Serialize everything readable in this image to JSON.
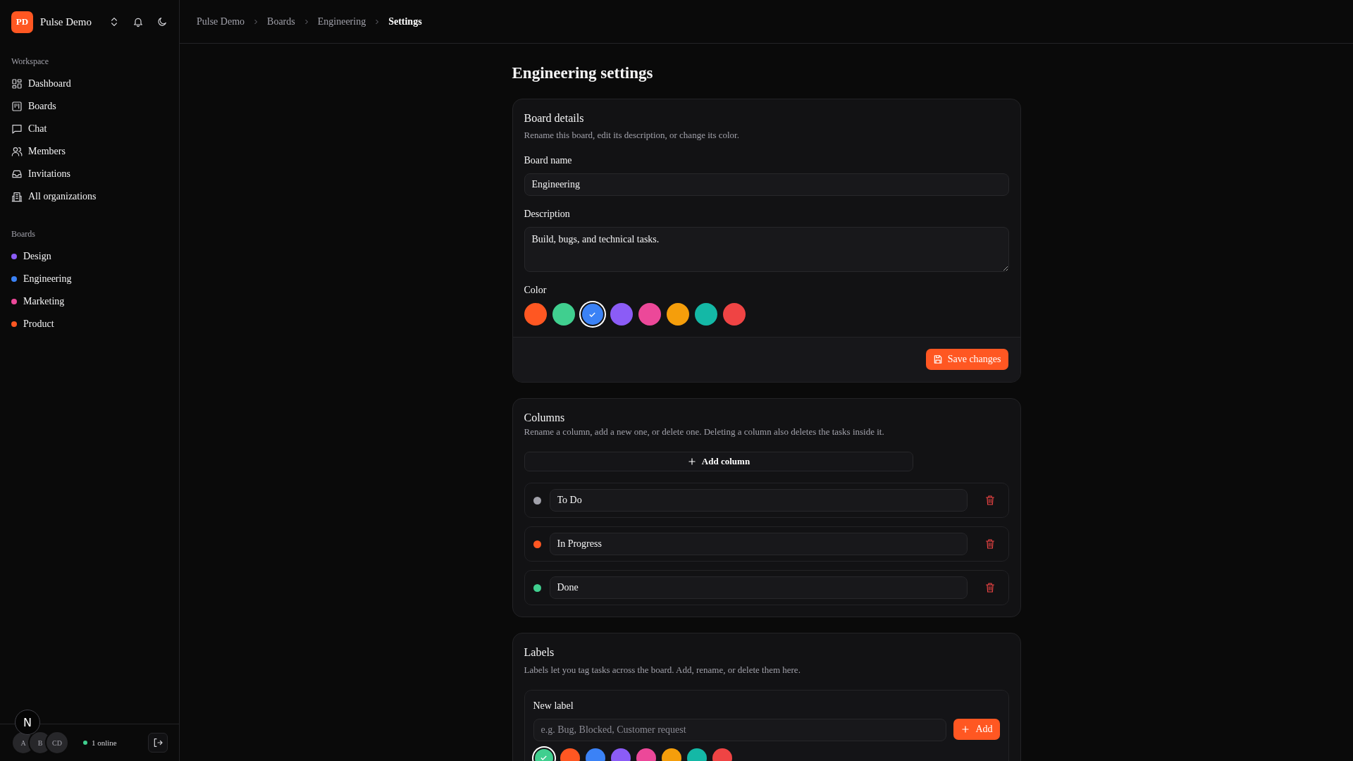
{
  "org": {
    "initials": "PD",
    "name": "Pulse Demo"
  },
  "sidebar": {
    "workspace_heading": "Workspace",
    "items": [
      {
        "label": "Dashboard",
        "kind": "dashboard",
        "selected": false
      },
      {
        "label": "Boards",
        "kind": "boards",
        "selected": false
      },
      {
        "label": "Chat",
        "kind": "chat",
        "selected": false
      },
      {
        "label": "Members",
        "kind": "members",
        "selected": false
      },
      {
        "label": "Invitations",
        "kind": "inbox",
        "selected": false
      },
      {
        "label": "All organizations",
        "kind": "building",
        "selected": false
      }
    ],
    "boards_heading": "Boards",
    "boards": [
      {
        "label": "Design",
        "color": "#8b5cf6"
      },
      {
        "label": "Engineering",
        "color": "#3b82f6"
      },
      {
        "label": "Marketing",
        "color": "#ec4899"
      },
      {
        "label": "Product",
        "color": "#ff5722"
      }
    ],
    "avatars": [
      "A",
      "B",
      "CD"
    ],
    "dev_badge": "N",
    "online": "1 online"
  },
  "breadcrumbs": [
    "Pulse Demo",
    "Boards",
    "Engineering",
    "Settings"
  ],
  "page_title": "Engineering settings",
  "board_details": {
    "title": "Board details",
    "subtitle": "Rename this board, edit its description, or change its color.",
    "name_label": "Board name",
    "name_value": "Engineering",
    "description_label": "Description",
    "description_value": "Build, bugs, and technical tasks.",
    "color_label": "Color",
    "colors": [
      {
        "color": "#ff5722",
        "selected": false
      },
      {
        "color": "#40cf8f",
        "selected": false
      },
      {
        "color": "#3b82f6",
        "selected": true
      },
      {
        "color": "#8b5cf6",
        "selected": false
      },
      {
        "color": "#ec4899",
        "selected": false
      },
      {
        "color": "#f59e0b",
        "selected": false
      },
      {
        "color": "#14b8a6",
        "selected": false
      },
      {
        "color": "#ef4444",
        "selected": false
      }
    ],
    "save_button": "Save changes"
  },
  "columns": {
    "title": "Columns",
    "subtitle": "Rename a column, add a new one, or delete one. Deleting a column also deletes the tasks inside it.",
    "add_button": "Add column",
    "items": [
      {
        "name": "To Do",
        "color": "#a1a1aa"
      },
      {
        "name": "In Progress",
        "color": "#ff5722"
      },
      {
        "name": "Done",
        "color": "#40cf8f"
      }
    ]
  },
  "labels": {
    "title": "Labels",
    "subtitle": "Labels let you tag tasks across the board. Add, rename, or delete them here.",
    "new_label_heading": "New label",
    "placeholder": "e.g. Bug, Blocked, Customer request",
    "add_button": "Add",
    "colors": [
      {
        "color": "#40cf8f",
        "selected": true
      },
      {
        "color": "#ff5722",
        "selected": false
      },
      {
        "color": "#3b82f6",
        "selected": false
      },
      {
        "color": "#8b5cf6",
        "selected": false
      },
      {
        "color": "#ec4899",
        "selected": false
      },
      {
        "color": "#f59e0b",
        "selected": false
      },
      {
        "color": "#14b8a6",
        "selected": false
      },
      {
        "color": "#ef4444",
        "selected": false
      }
    ]
  }
}
